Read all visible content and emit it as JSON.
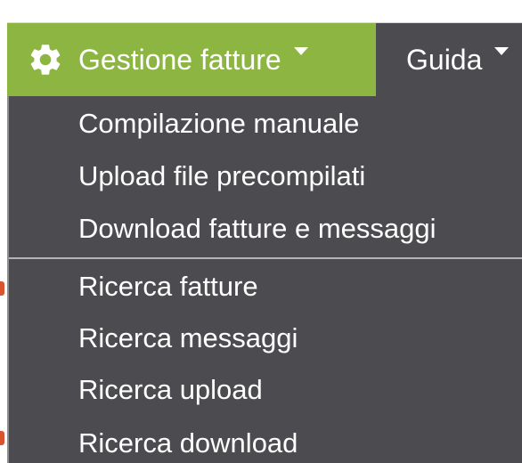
{
  "colors": {
    "menu_bg": "#4c4c50",
    "active_bg": "#8db541",
    "text": "#ffffff",
    "divider": "#b4b4b8"
  },
  "navbar": {
    "items": [
      {
        "label": "Gestione fatture",
        "icon": "gear-icon",
        "active": true
      },
      {
        "label": "Guida",
        "active": false
      }
    ]
  },
  "dropdown": {
    "groups": [
      [
        "Compilazione manuale",
        "Upload file precompilati",
        "Download fatture e messaggi"
      ],
      [
        "Ricerca fatture",
        "Ricerca messaggi",
        "Ricerca upload",
        "Ricerca download"
      ]
    ]
  }
}
